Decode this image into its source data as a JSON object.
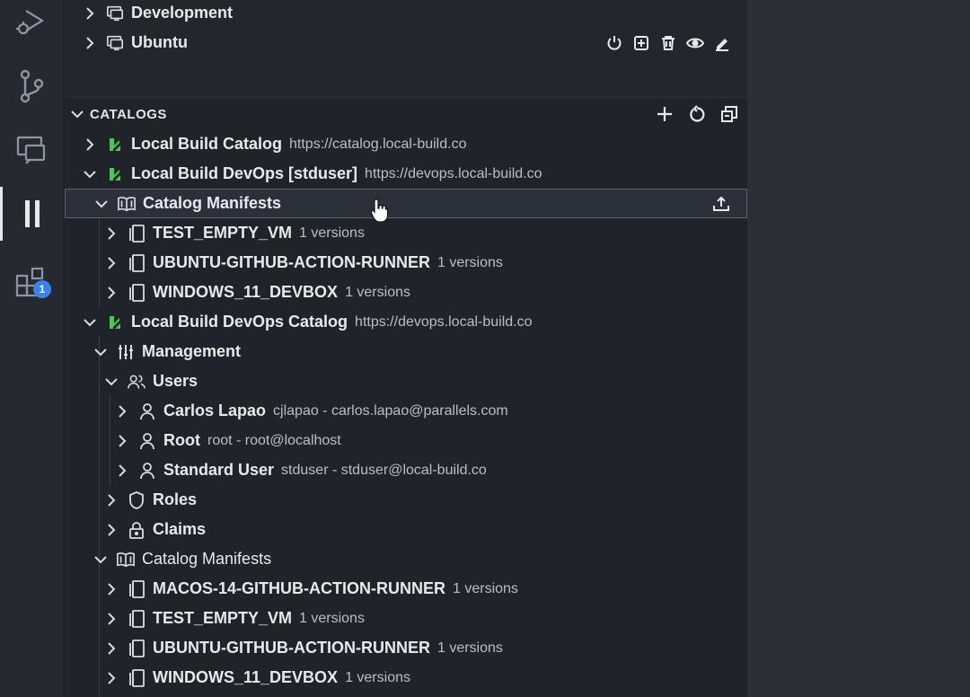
{
  "colors": {
    "accent": "#3b83e6",
    "catalog_icon": "#4fc45a",
    "background": "#1e2228"
  },
  "activity_bar": {
    "items": [
      {
        "name": "run-debug-icon"
      },
      {
        "name": "source-control-icon"
      },
      {
        "name": "remote-explorer-icon"
      },
      {
        "name": "parallels-icon"
      },
      {
        "name": "extensions-icon",
        "badge": "1"
      }
    ]
  },
  "machines": [
    {
      "label": "Development"
    },
    {
      "label": "Ubuntu",
      "actions": [
        "power-icon",
        "add-icon",
        "trash-icon",
        "eye-icon",
        "edit-icon"
      ]
    }
  ],
  "catalogs": {
    "title": "CATALOGS",
    "actions": [
      "add-icon",
      "refresh-icon",
      "collapse-all-icon"
    ],
    "rows": [
      {
        "label": "Local Build Catalog",
        "desc": "https://catalog.local-build.co"
      },
      {
        "label": "Local Build DevOps [stduser]",
        "desc": "https://devops.local-build.co"
      },
      {
        "label": "Catalog Manifests",
        "desc": ""
      },
      {
        "label": "TEST_EMPTY_VM",
        "desc": "1 versions"
      },
      {
        "label": "UBUNTU-GITHUB-ACTION-RUNNER",
        "desc": "1 versions"
      },
      {
        "label": "WINDOWS_11_DEVBOX",
        "desc": "1 versions"
      },
      {
        "label": "Local Build DevOps Catalog",
        "desc": "https://devops.local-build.co"
      },
      {
        "label": "Management",
        "desc": ""
      },
      {
        "label": "Users",
        "desc": ""
      },
      {
        "label": "Carlos Lapao",
        "desc": "cjlapao - carlos.lapao@parallels.com"
      },
      {
        "label": "Root",
        "desc": "root - root@localhost"
      },
      {
        "label": "Standard User",
        "desc": "stduser - stduser@local-build.co"
      },
      {
        "label": "Roles",
        "desc": ""
      },
      {
        "label": "Claims",
        "desc": ""
      },
      {
        "label": "Catalog Manifests",
        "desc": ""
      },
      {
        "label": "MACOS-14-GITHUB-ACTION-RUNNER",
        "desc": "1 versions"
      },
      {
        "label": "TEST_EMPTY_VM",
        "desc": "1 versions"
      },
      {
        "label": "UBUNTU-GITHUB-ACTION-RUNNER",
        "desc": "1 versions"
      },
      {
        "label": "WINDOWS_11_DEVBOX",
        "desc": "1 versions"
      }
    ]
  }
}
